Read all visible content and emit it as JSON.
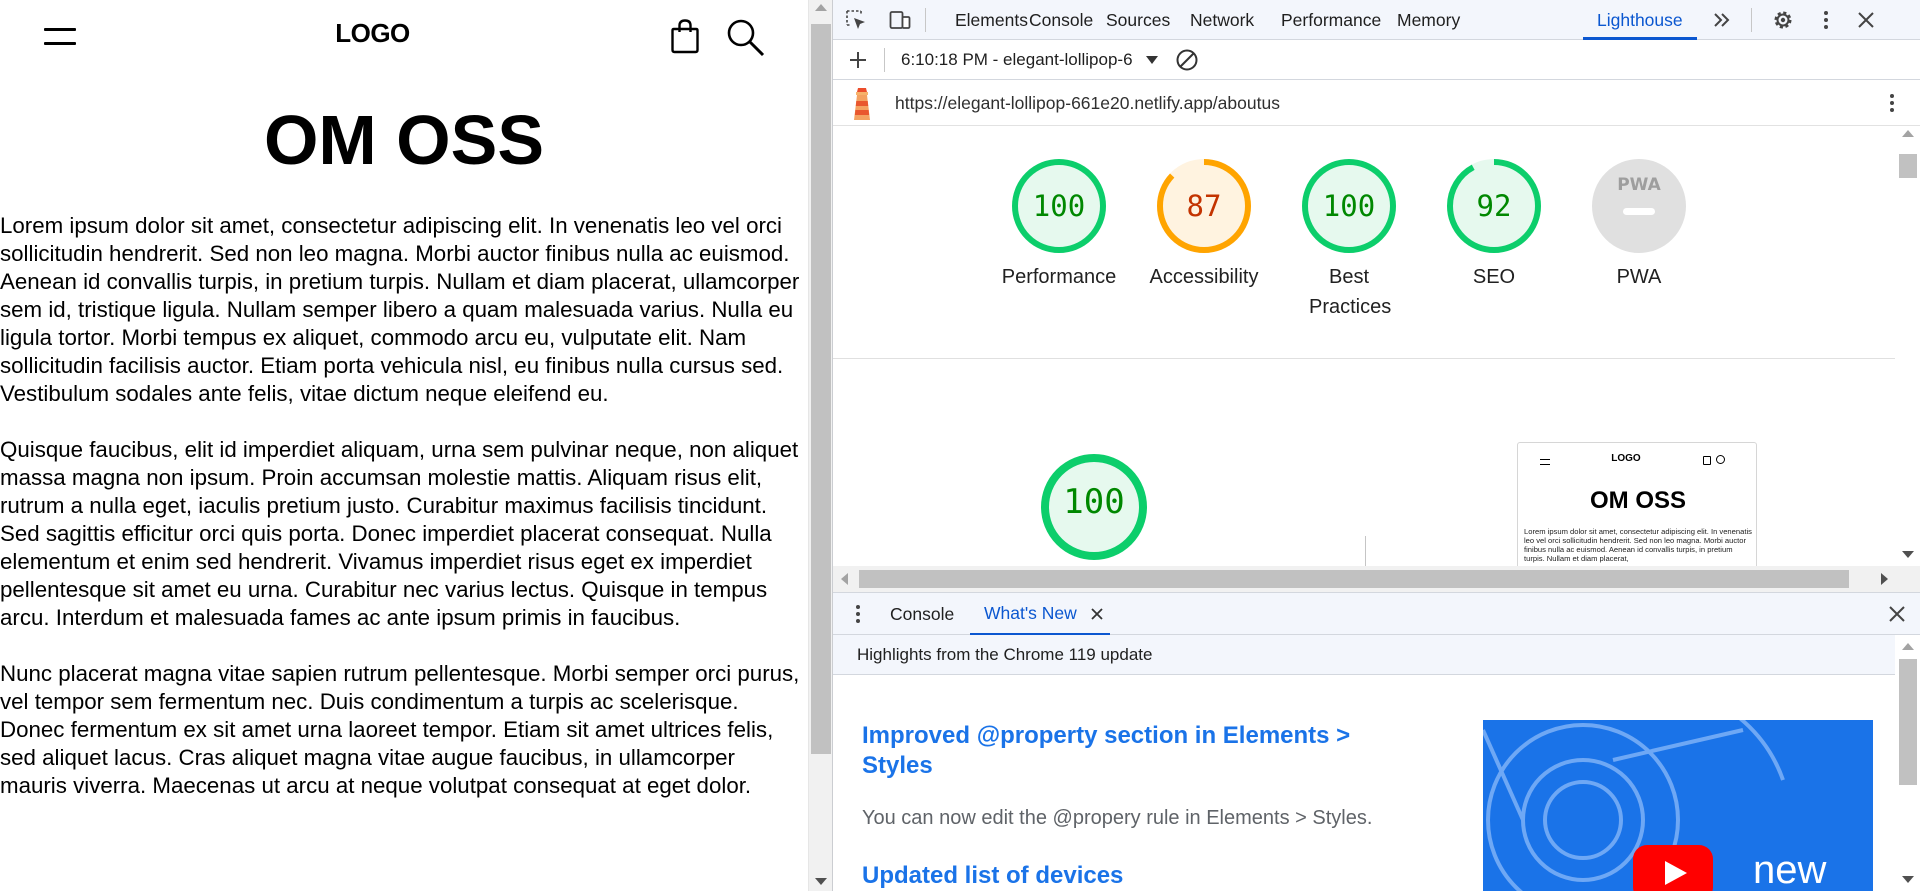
{
  "site": {
    "logo": "LOGO",
    "title": "OM OSS",
    "paragraphs": [
      "Lorem ipsum dolor sit amet, consectetur adipiscing elit. In venenatis leo vel orci sollicitudin hendrerit. Sed non leo magna. Morbi auctor finibus nulla ac euismod. Aenean id convallis turpis, in pretium turpis. Nullam et diam placerat, ullamcorper sem id, tristique ligula. Nullam semper libero a quam malesuada varius. Nulla eu ligula tortor. Morbi tempus ex aliquet, commodo arcu eu, vulputate elit. Nam sollicitudin facilisis auctor. Etiam porta vehicula nisl, eu finibus nulla cursus sed. Vestibulum sodales ante felis, vitae dictum neque eleifend eu.",
      "Quisque faucibus, elit id imperdiet aliquam, urna sem pulvinar neque, non aliquet massa magna non ipsum. Proin accumsan molestie mattis. Aliquam risus elit, rutrum a nulla eget, iaculis pretium justo. Curabitur maximus facilisis tincidunt. Sed sagittis efficitur orci quis porta. Donec imperdiet placerat consequat. Nulla elementum et enim sed hendrerit. Vivamus imperdiet risus eget ex imperdiet pellentesque sit amet eu urna. Curabitur nec varius lectus. Quisque in tempus arcu. Interdum et malesuada fames ac ante ipsum primis in faucibus.",
      "Nunc placerat magna vitae sapien rutrum pellentesque. Morbi semper orci purus, vel tempor sem fermentum nec. Duis condimentum a turpis ac scelerisque. Donec fermentum ex sit amet urna laoreet tempor. Etiam sit amet ultrices felis, sed aliquet lacus. Cras aliquet magna vitae augue faucibus, in ullamcorper mauris viverra. Maecenas ut arcu at neque volutpat consequat at eget dolor."
    ]
  },
  "devtools": {
    "tabs": [
      "Elements",
      "Console",
      "Sources",
      "Network",
      "Performance",
      "Memory",
      "Lighthouse"
    ],
    "active_tab": "Lighthouse",
    "toolbar": {
      "report_select": "6:10:18 PM - elegant-lollipop-6"
    },
    "url": "https://elegant-lollipop-661e20.netlify.app/aboutus",
    "scores": [
      {
        "label": "Performance",
        "value": "100",
        "color": "#0cce6b",
        "fill": "#e6f9ee",
        "text": "#008800"
      },
      {
        "label": "Accessibility",
        "value": "87",
        "color": "#ffa400",
        "fill": "#fff3e0",
        "text": "#c33300"
      },
      {
        "label": "Best Practices",
        "value": "100",
        "color": "#0cce6b",
        "fill": "#e6f9ee",
        "text": "#008800"
      },
      {
        "label": "SEO",
        "value": "92",
        "color": "#0cce6b",
        "fill": "#e6f9ee",
        "text": "#008800"
      },
      {
        "label": "PWA",
        "value": "PWA",
        "color": "#e0e0e0",
        "fill": "#e0e0e0",
        "text": "#9e9e9e"
      }
    ],
    "big_score": "100",
    "preview": {
      "logo": "LOGO",
      "title": "OM OSS",
      "text": "Lorem ipsum dolor sit amet, consectetur adipiscing elit. In venenatis leo vel orci sollicitudin hendrerit. Sed non leo magna. Morbi auctor finibus nulla ac euismod. Aenean id convallis turpis, in pretium turpis. Nullam et diam placerat,"
    },
    "drawer": {
      "tabs": [
        "Console",
        "What's New"
      ],
      "active_tab": "What's New",
      "subtitle": "Highlights from the Chrome 119 update",
      "items": [
        {
          "title": "Improved @property section in Elements > Styles",
          "body": "You can now edit the @propery rule in Elements > Styles."
        },
        {
          "title": "Updated list of devices",
          "body": ""
        }
      ],
      "video_caption": "new"
    }
  }
}
